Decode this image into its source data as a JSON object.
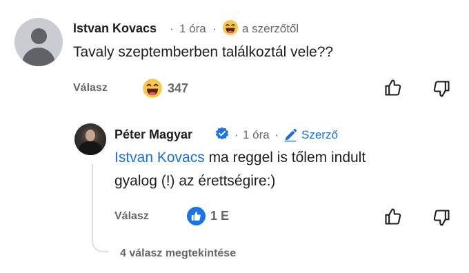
{
  "comment": {
    "author": "Istvan Kovacs",
    "time": "1 óra",
    "badge_text": "a szerzőtől",
    "text": "Tavaly szeptemberben találkoztál vele??",
    "reply_label": "Válasz",
    "reaction_count": "347",
    "reaction_icon": "laughing-emoji",
    "separator": "·"
  },
  "reply": {
    "author": "Péter Magyar",
    "time": "1 óra",
    "author_label": "Szerző",
    "mention": "Istvan Kovacs",
    "text_after_mention": " ma reggel is tőlem indult",
    "text_line2": "gyalog (!) az érettségire:)",
    "reply_label": "Válasz",
    "reaction_count": "1 E",
    "reaction_icon": "like-icon",
    "separator": "·"
  },
  "view_replies": "4 válasz megtekintése",
  "colors": {
    "link": "#1a6ed8",
    "muted": "#65676b",
    "like_badge": "#1b74e4",
    "emoji": "#f7c64a"
  }
}
